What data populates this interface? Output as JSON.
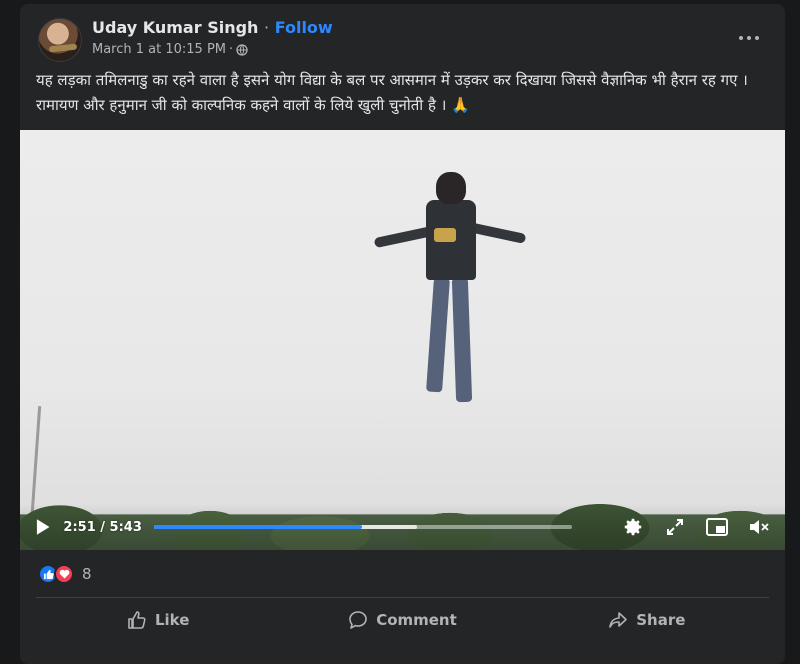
{
  "post": {
    "author": "Uday Kumar Singh",
    "separator": "·",
    "follow_label": "Follow",
    "timestamp": "March 1 at 10:15 PM",
    "meta_separator": "·",
    "audience_icon": "globe-icon",
    "more_icon": "more-options-icon",
    "text": "यह लड़का तमिलनाडु का रहने वाला है इसने योग विद्या के बल पर आसमान में उड़कर कर दिखाया जिससे वैज्ञानिक भी हैरान रह गए । रामायण और हनुमान जी को काल्पनिक कहने वालों के लिये खुली चुनोती है ।",
    "emoji": "🙏"
  },
  "video": {
    "current_time": "2:51",
    "time_separator": "/",
    "duration": "5:43",
    "time_display": "2:51 / 5:43",
    "progress_fraction": 0.498,
    "buffered_fraction": 0.63,
    "accent_color": "#2d88ff",
    "icons": [
      "play-icon",
      "settings-icon",
      "fullscreen-icon",
      "picture-in-picture-icon",
      "mute-icon"
    ]
  },
  "reactions": {
    "types": [
      "like-icon",
      "love-icon"
    ],
    "count": "8"
  },
  "actions": {
    "like_label": "Like",
    "comment_label": "Comment",
    "share_label": "Share"
  }
}
